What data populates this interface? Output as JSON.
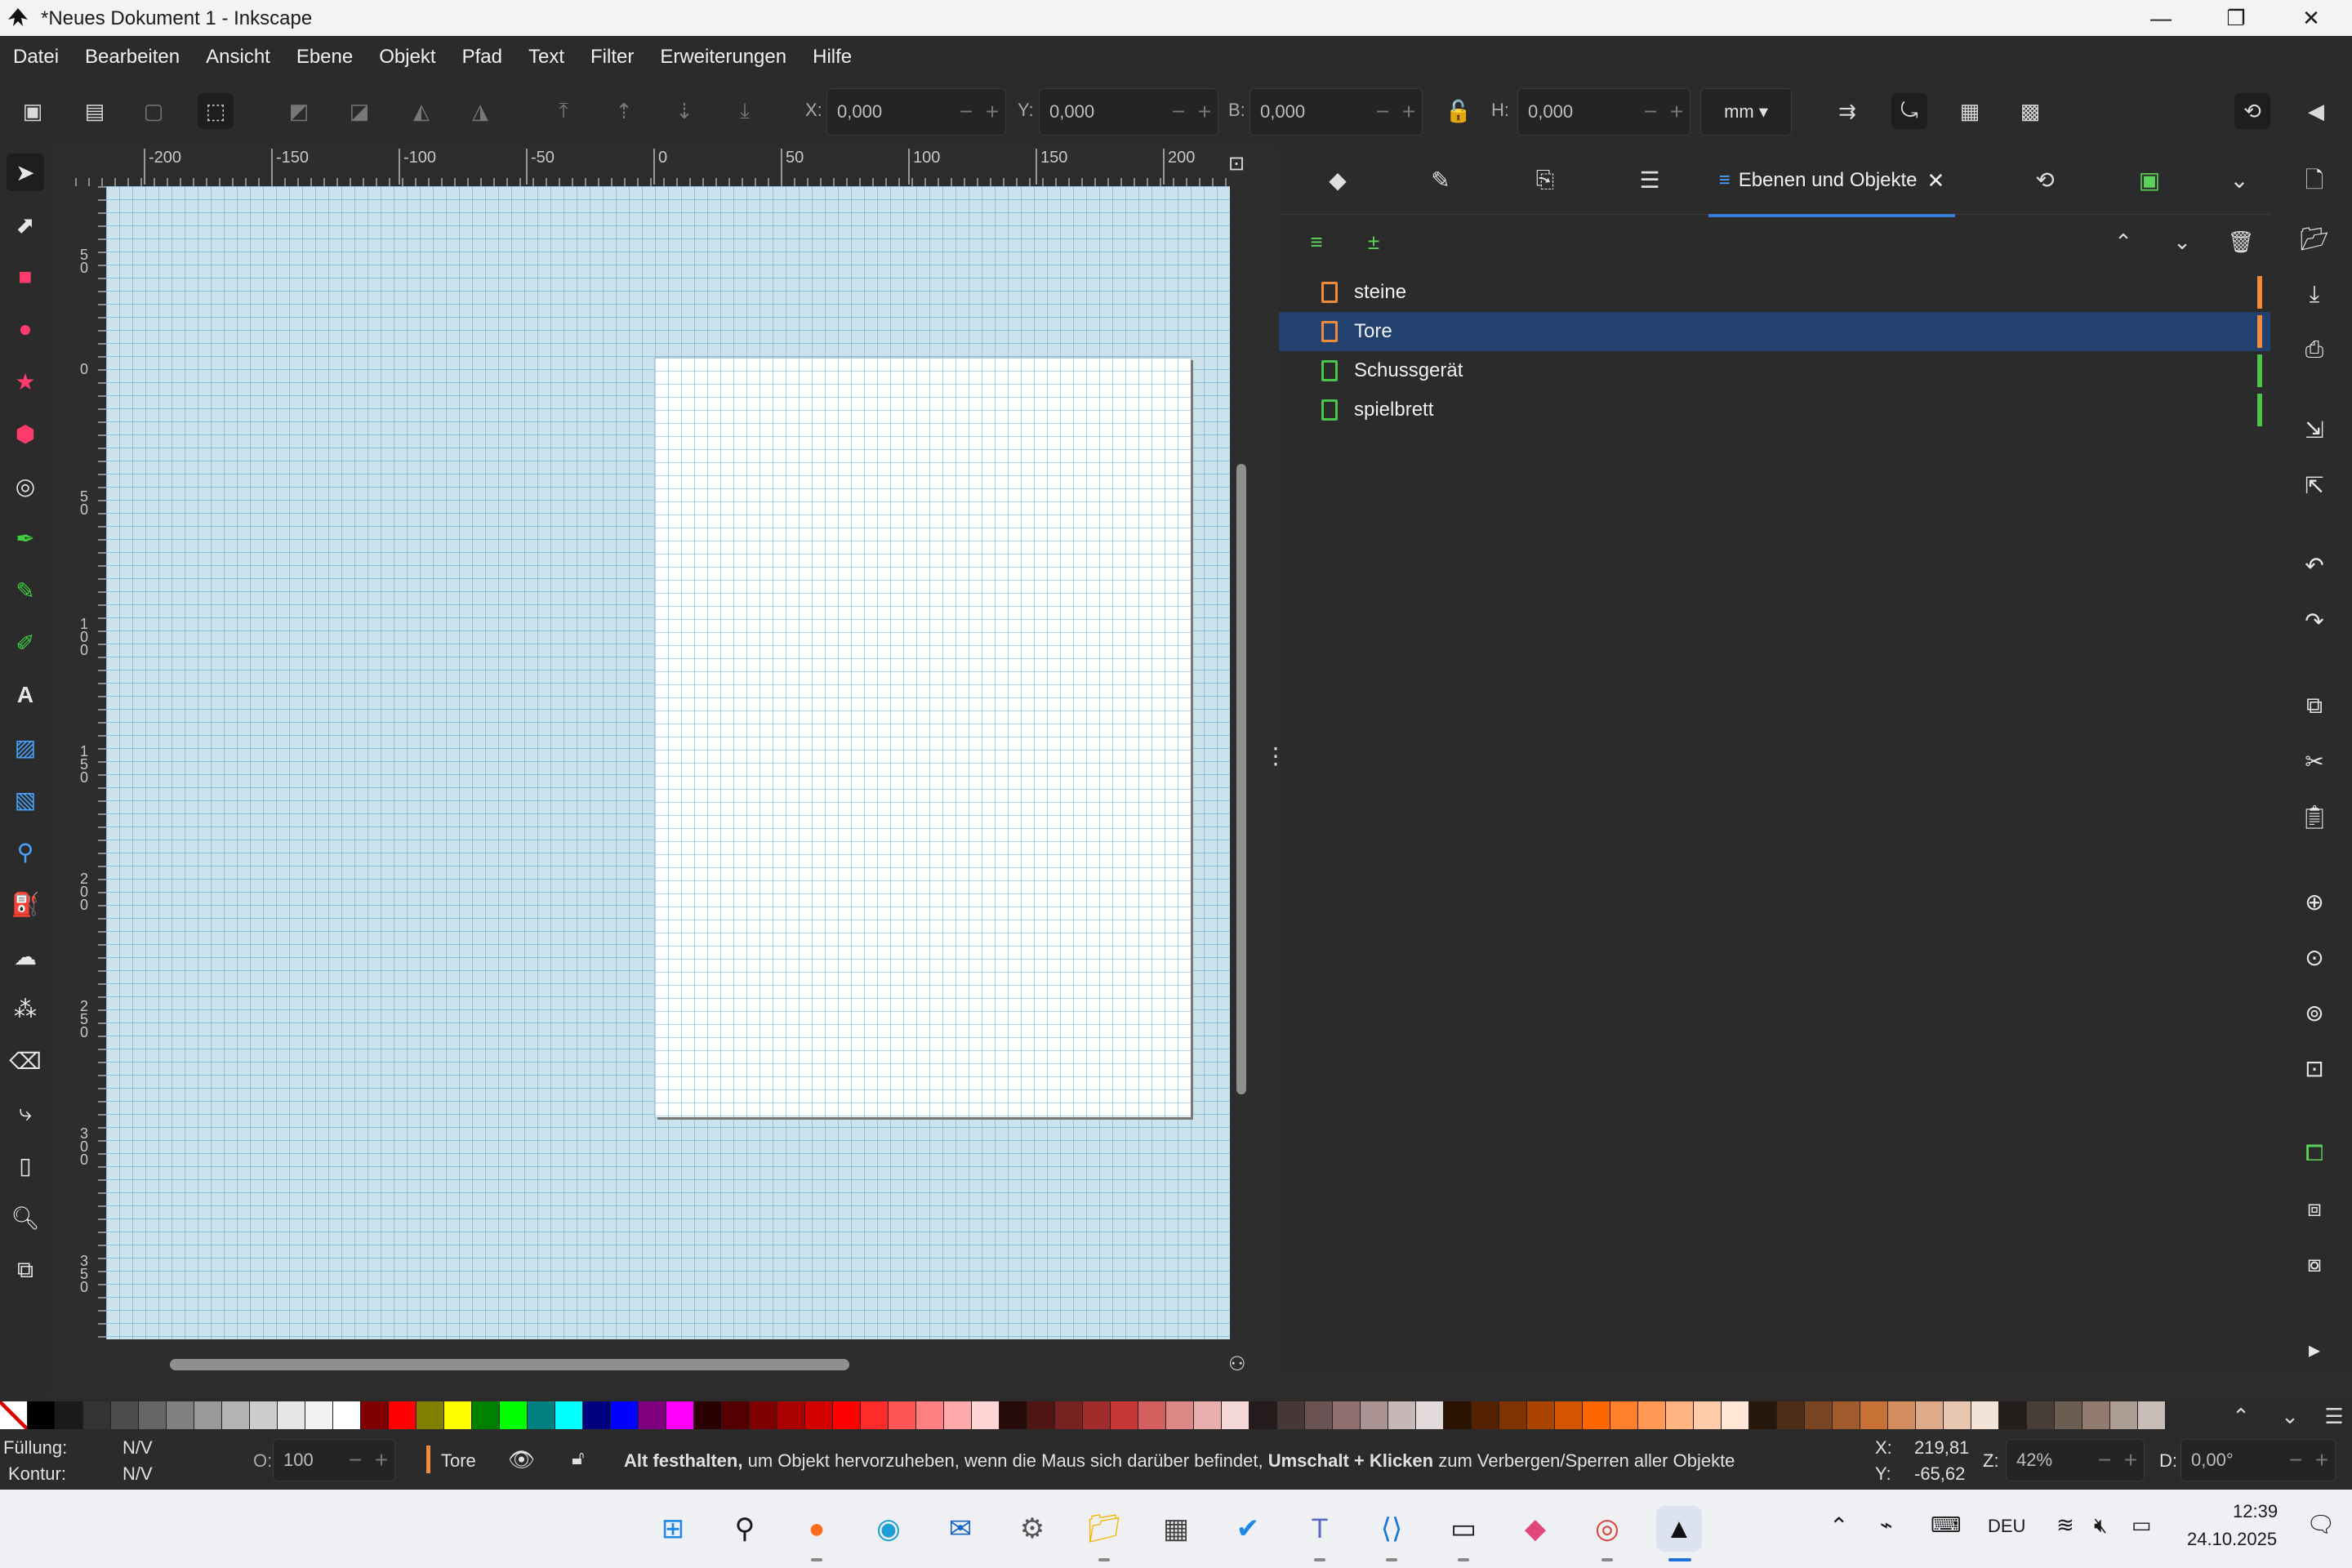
{
  "window": {
    "title": "*Neues Dokument 1 - Inkscape",
    "minimize": "—",
    "maximize": "❐",
    "close": "✕"
  },
  "menu": [
    "Datei",
    "Bearbeiten",
    "Ansicht",
    "Ebene",
    "Objekt",
    "Pfad",
    "Text",
    "Filter",
    "Erweiterungen",
    "Hilfe"
  ],
  "toolbar": {
    "x_label": "X:",
    "x_value": "0,000",
    "y_label": "Y:",
    "y_value": "0,000",
    "w_label": "B:",
    "w_value": "0,000",
    "h_label": "H:",
    "h_value": "0,000",
    "unit": "mm"
  },
  "ruler_top": [
    "-200",
    "-150",
    "-100",
    "-50",
    "0",
    "50",
    "100",
    "150",
    "200"
  ],
  "ruler_left": [
    "5 0",
    "0",
    "5 0",
    "1 0 0",
    "1 5 0",
    "2 0 0",
    "2 5 0",
    "3 0 0",
    "3 5 0"
  ],
  "dock": {
    "active_tab": "Ebenen und Objekte",
    "layers": [
      {
        "name": "steine",
        "color": "#f08a3c",
        "selected": false
      },
      {
        "name": "Tore",
        "color": "#f08a3c",
        "selected": true
      },
      {
        "name": "Schussgerät",
        "color": "#4cc44c",
        "selected": false
      },
      {
        "name": "spielbrett",
        "color": "#4cc44c",
        "selected": false
      }
    ]
  },
  "palette": [
    "#000000",
    "#1a1a1a",
    "#333333",
    "#4d4d4d",
    "#666666",
    "#808080",
    "#999999",
    "#b3b3b3",
    "#cccccc",
    "#e6e6e6",
    "#f2f2f2",
    "#ffffff",
    "#800000",
    "#ff0000",
    "#808000",
    "#ffff00",
    "#008000",
    "#00ff00",
    "#008080",
    "#00ffff",
    "#000080",
    "#0000ff",
    "#800080",
    "#ff00ff",
    "#2b0000",
    "#550000",
    "#800000",
    "#aa0000",
    "#d40000",
    "#ff0000",
    "#ff2a2a",
    "#ff5555",
    "#ff8080",
    "#ffaaaa",
    "#ffd5d5",
    "#280b0b",
    "#501616",
    "#782121",
    "#a02c2c",
    "#c83737",
    "#d35f5f",
    "#de8787",
    "#e9afaf",
    "#f4d7d7",
    "#241c1c",
    "#483737",
    "#6c5353",
    "#916f6f",
    "#ac9393",
    "#c8b7b7",
    "#e3dbdb",
    "#2b1100",
    "#552200",
    "#803300",
    "#aa4400",
    "#d45500",
    "#ff6600",
    "#ff7f2a",
    "#ff9955",
    "#ffb380",
    "#ffccaa",
    "#ffe6d5",
    "#28170b",
    "#502d16",
    "#784421",
    "#a05a2c",
    "#c87137",
    "#d38d5f",
    "#deaa87",
    "#e9c6af",
    "#f4e3d7",
    "#241f1c",
    "#483e37",
    "#6c5d53",
    "#917c6f",
    "#ac9d93",
    "#c8beb7"
  ],
  "status": {
    "fill_label": "Füllung:",
    "fill_value": "N/V",
    "stroke_label": "Kontur:",
    "stroke_value": "N/V",
    "opacity_label": "O:",
    "opacity_value": "100",
    "current_layer": "Tore",
    "hint_part1": "Alt festhalten,",
    "hint_part2": " um Objekt hervorzuheben, wenn die Maus sich darüber befindet, ",
    "hint_part3": "Umschalt + Klicken",
    "hint_part4": " zum Verbergen/Sperren aller Objekte",
    "x_label": "X:",
    "x_value": "219,81",
    "y_label": "Y:",
    "y_value": "-65,62",
    "zoom_label": "Z:",
    "zoom_value": "42%",
    "rotation_label": "D:",
    "rotation_value": "0,00°"
  },
  "taskbar": {
    "language": "DEU",
    "time": "12:39",
    "date": "24.10.2025"
  }
}
